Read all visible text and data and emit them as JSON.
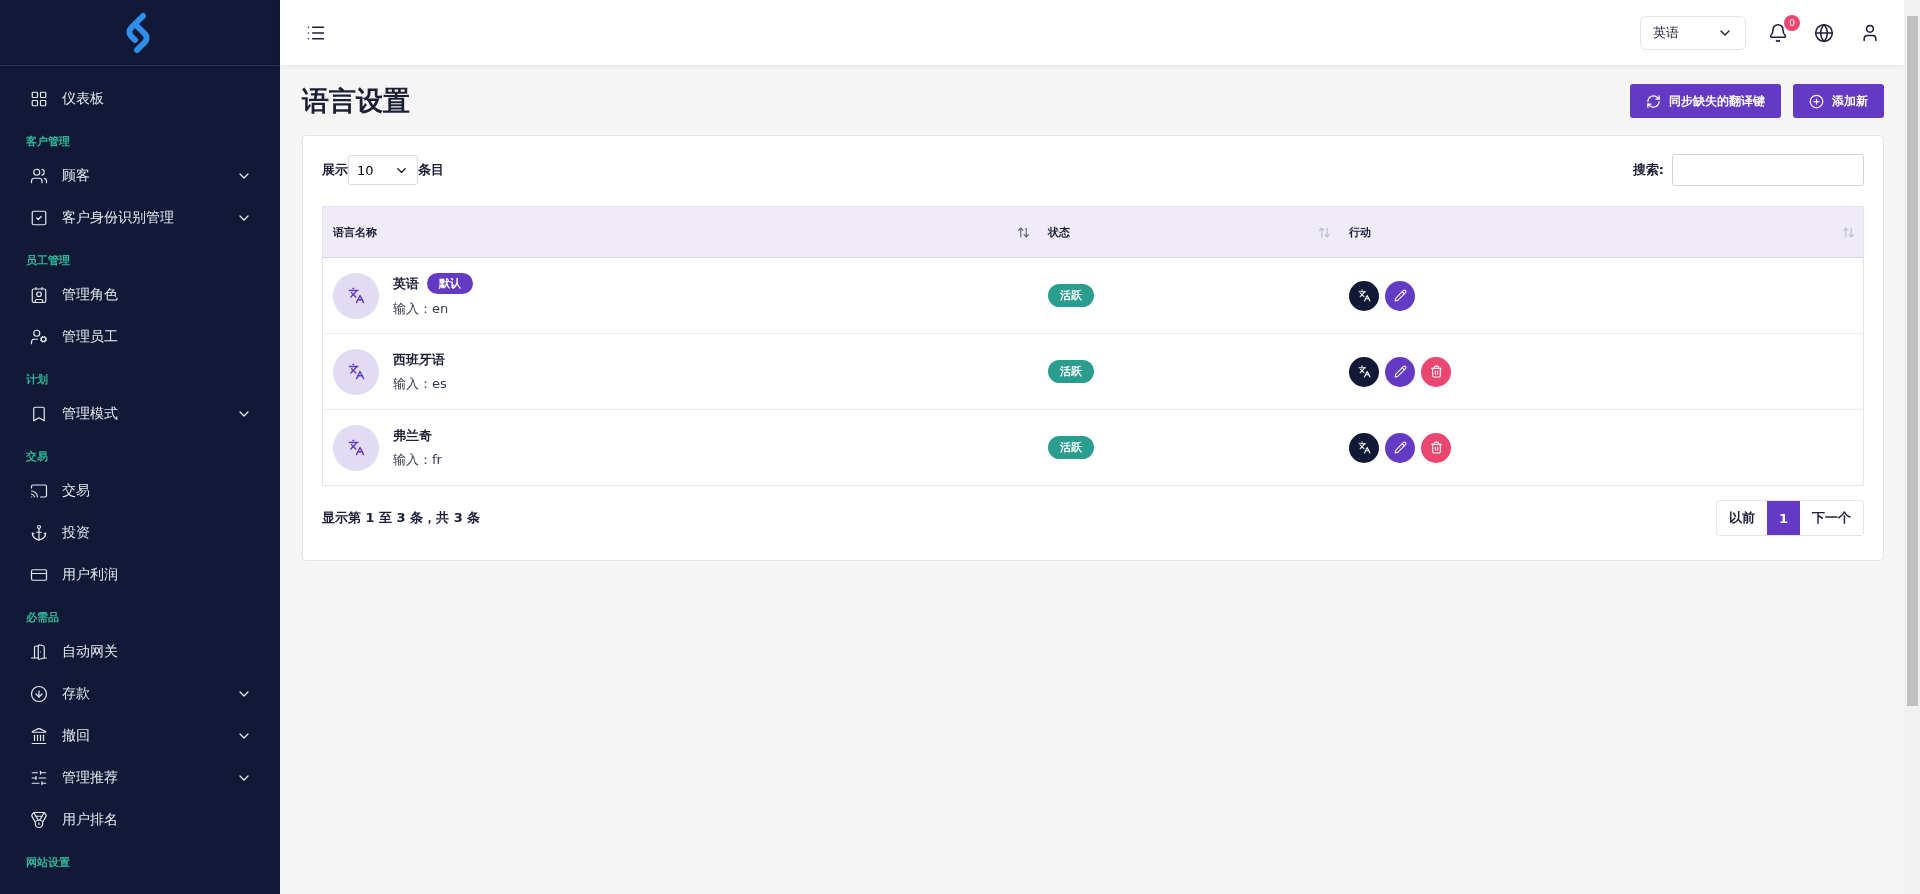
{
  "sidebar": {
    "groups": [
      {
        "items": [
          {
            "label": "仪表板",
            "expandable": false
          }
        ]
      },
      {
        "title": "客户管理",
        "items": [
          {
            "label": "顾客",
            "expandable": true
          },
          {
            "label": "客户身份识别管理",
            "expandable": true
          }
        ]
      },
      {
        "title": "员工管理",
        "items": [
          {
            "label": "管理角色",
            "expandable": false
          },
          {
            "label": "管理员工",
            "expandable": false
          }
        ]
      },
      {
        "title": "计划",
        "items": [
          {
            "label": "管理模式",
            "expandable": true
          }
        ]
      },
      {
        "title": "交易",
        "items": [
          {
            "label": "交易",
            "expandable": false
          },
          {
            "label": "投资",
            "expandable": false
          },
          {
            "label": "用户利润",
            "expandable": false
          }
        ]
      },
      {
        "title": "必需品",
        "items": [
          {
            "label": "自动网关",
            "expandable": false
          },
          {
            "label": "存款",
            "expandable": true
          },
          {
            "label": "撤回",
            "expandable": true
          },
          {
            "label": "管理推荐",
            "expandable": true
          },
          {
            "label": "用户排名",
            "expandable": false
          }
        ]
      },
      {
        "title": "网站设置"
      }
    ]
  },
  "topbar": {
    "language": "英语",
    "notifications": "0"
  },
  "page": {
    "title": "语言设置",
    "buttons": [
      "同步缺失的翻译键",
      "添加新"
    ]
  },
  "table": {
    "show_label": "展示",
    "page_size": "10",
    "entries_label": "条目",
    "search_label": "搜索:",
    "columns": [
      {
        "label": "语言名称",
        "sort_active": true
      },
      {
        "label": "状态",
        "sort_active": false
      },
      {
        "label": "行动",
        "sort_active": false
      }
    ],
    "rows": [
      {
        "name": "英语",
        "badge": "默认",
        "code": "输入：en",
        "status": "活跃",
        "deletable": false
      },
      {
        "name": "西班牙语",
        "code": "输入：es",
        "status": "活跃",
        "deletable": true
      },
      {
        "name": "弗兰奇",
        "code": "输入：fr",
        "status": "活跃",
        "deletable": true
      }
    ],
    "info": "显示第 1 至 3 条，共 3 条",
    "pagination": [
      {
        "label": "以前",
        "selected": false
      },
      {
        "label": "1",
        "selected": true
      },
      {
        "label": "下一个",
        "selected": false
      }
    ]
  }
}
